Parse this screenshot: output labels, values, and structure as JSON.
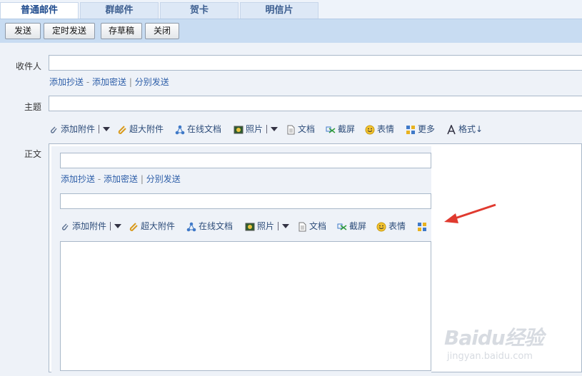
{
  "tabs": [
    {
      "label": "普通邮件"
    },
    {
      "label": "群邮件"
    },
    {
      "label": "贺卡"
    },
    {
      "label": "明信片"
    }
  ],
  "toolbar": {
    "send": "发送",
    "scheduled_send": "定时发送",
    "save_draft": "存草稿",
    "close": "关闭"
  },
  "form": {
    "to_label": "收件人",
    "links": {
      "add_cc": "添加抄送",
      "dash": "-",
      "add_bcc": "添加密送",
      "sep": "|",
      "separate_send": "分别发送"
    },
    "subject_label": "主题",
    "body_label": "正文"
  },
  "attach": {
    "attachment": "添加附件",
    "large_attachment": "超大附件",
    "online_doc": "在线文档",
    "photo": "照片",
    "document": "文档",
    "screenshot": "截屏",
    "emoji": "表情",
    "more": "更多",
    "format": "格式↓"
  },
  "colors": {
    "accent": "#2d5ea8",
    "arrow": "#e03a2f"
  },
  "watermark": {
    "brand": "Baidu经验",
    "url": "jingyan.baidu.com"
  }
}
